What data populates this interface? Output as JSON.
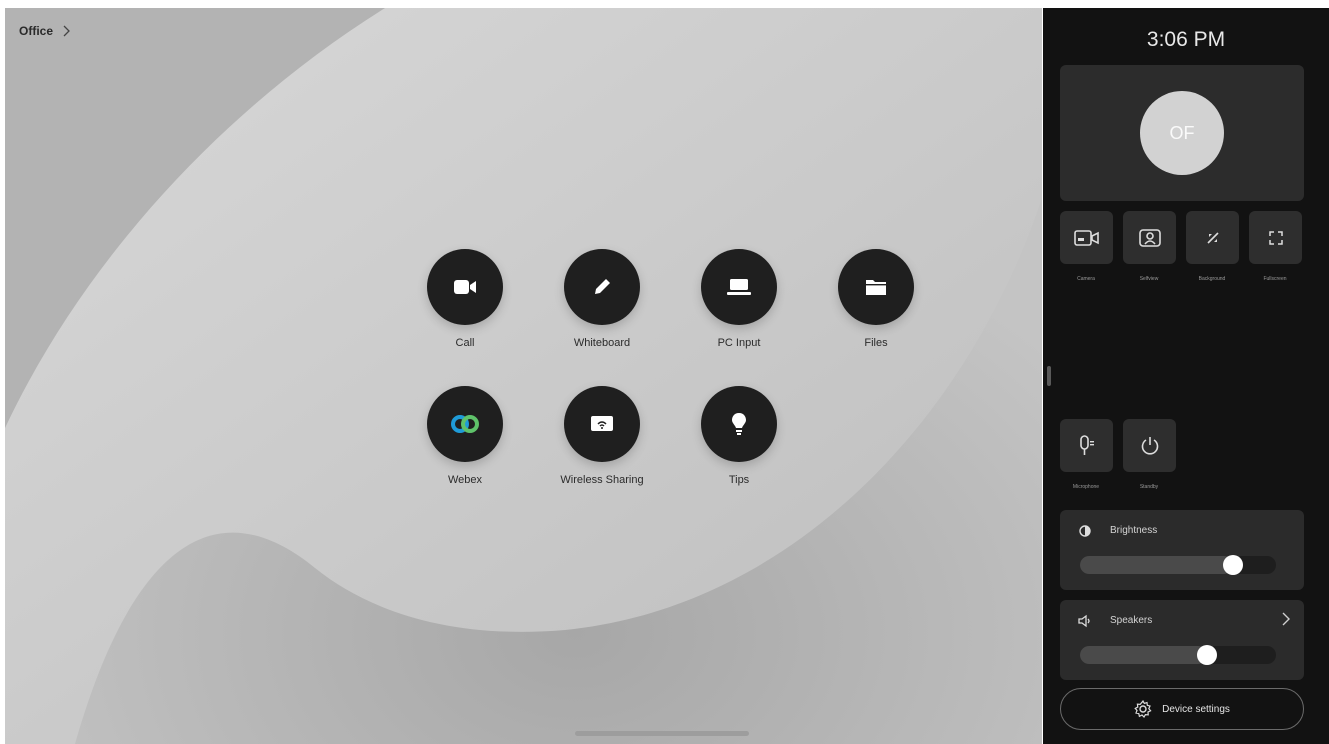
{
  "breadcrumb": {
    "label": "Office"
  },
  "apps": [
    {
      "id": "call",
      "label": "Call",
      "icon": "video-camera-icon"
    },
    {
      "id": "whiteboard",
      "label": "Whiteboard",
      "icon": "pencil-icon"
    },
    {
      "id": "pc-input",
      "label": "PC Input",
      "icon": "laptop-icon"
    },
    {
      "id": "files",
      "label": "Files",
      "icon": "folder-icon"
    },
    {
      "id": "webex",
      "label": "Webex",
      "icon": "webex-logo-icon"
    },
    {
      "id": "wireless-sharing",
      "label": "Wireless Sharing",
      "icon": "screen-share-icon"
    },
    {
      "id": "tips",
      "label": "Tips",
      "icon": "lightbulb-icon"
    }
  ],
  "panel": {
    "clock": "3:06 PM",
    "avatar_initials": "OF",
    "quick_settings": [
      {
        "label": "Camera",
        "icon": "camera-icon"
      },
      {
        "label": "Selfview",
        "icon": "selfview-icon"
      },
      {
        "label": "Background",
        "icon": "background-icon"
      },
      {
        "label": "Fullscreen",
        "icon": "fullscreen-icon"
      }
    ],
    "bottom_settings": [
      {
        "label": "Microphone",
        "icon": "microphone-icon"
      },
      {
        "label": "Standby",
        "icon": "power-icon"
      }
    ],
    "brightness": {
      "label": "Brightness",
      "value": 0.78
    },
    "speakers": {
      "label": "Speakers",
      "value": 0.65
    },
    "device_settings_label": "Device settings"
  },
  "colors": {
    "panel_bg": "#121212",
    "tile_bg": "#2e2e2e",
    "app_circle": "#1f1f1f",
    "webex_blue": "#1f9bd8",
    "webex_green": "#5fc26a"
  }
}
